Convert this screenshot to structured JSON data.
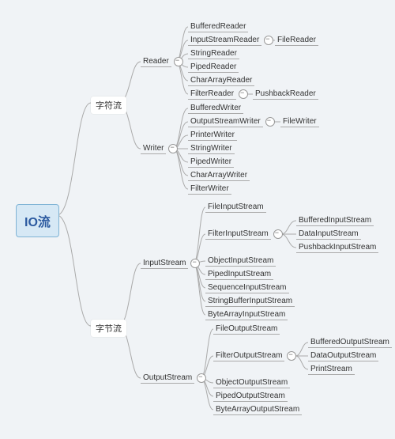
{
  "root": "IO流",
  "level1": {
    "charstream": "字符流",
    "bytestream": "字节流"
  },
  "charstream": {
    "reader": {
      "label": "Reader",
      "children": {
        "buffered": "BufferedReader",
        "isr": {
          "label": "InputStreamReader",
          "child": "FileReader"
        },
        "string": "StringReader",
        "piped": "PipedReader",
        "chararray": "CharArrayReader",
        "filter": {
          "label": "FilterReader",
          "child": "PushbackReader"
        }
      }
    },
    "writer": {
      "label": "Writer",
      "children": {
        "buffered": "BufferedWriter",
        "osw": {
          "label": "OutputStreamWriter",
          "child": "FileWriter"
        },
        "printer": "PrinterWriter",
        "string": "StringWriter",
        "piped": "PipedWriter",
        "chararray": "CharArrayWriter",
        "filter": "FilterWriter"
      }
    }
  },
  "bytestream": {
    "input": {
      "label": "InputStream",
      "children": {
        "file": "FileInputStream",
        "filter": {
          "label": "FilterInputStream",
          "children": {
            "buffered": "BufferedInputStream",
            "data": "DataInputStream",
            "pushback": "PushbackInputStream"
          }
        },
        "object": "ObjectInputStream",
        "piped": "PipedInputStream",
        "sequence": "SequenceInputStream",
        "stringbuf": "StringBufferInputStream",
        "bytearray": "ByteArrayInputStream"
      }
    },
    "output": {
      "label": "OutputStream",
      "children": {
        "file": "FileOutputStream",
        "filter": {
          "label": "FilterOutputStream",
          "children": {
            "buffered": "BufferedOutputStream",
            "data": "DataOutputStream",
            "print": "PrintStream"
          }
        },
        "object": "ObjectOutputStream",
        "piped": "PipedOutputStream",
        "bytearray": "ByteArrayOutputStream"
      }
    }
  }
}
